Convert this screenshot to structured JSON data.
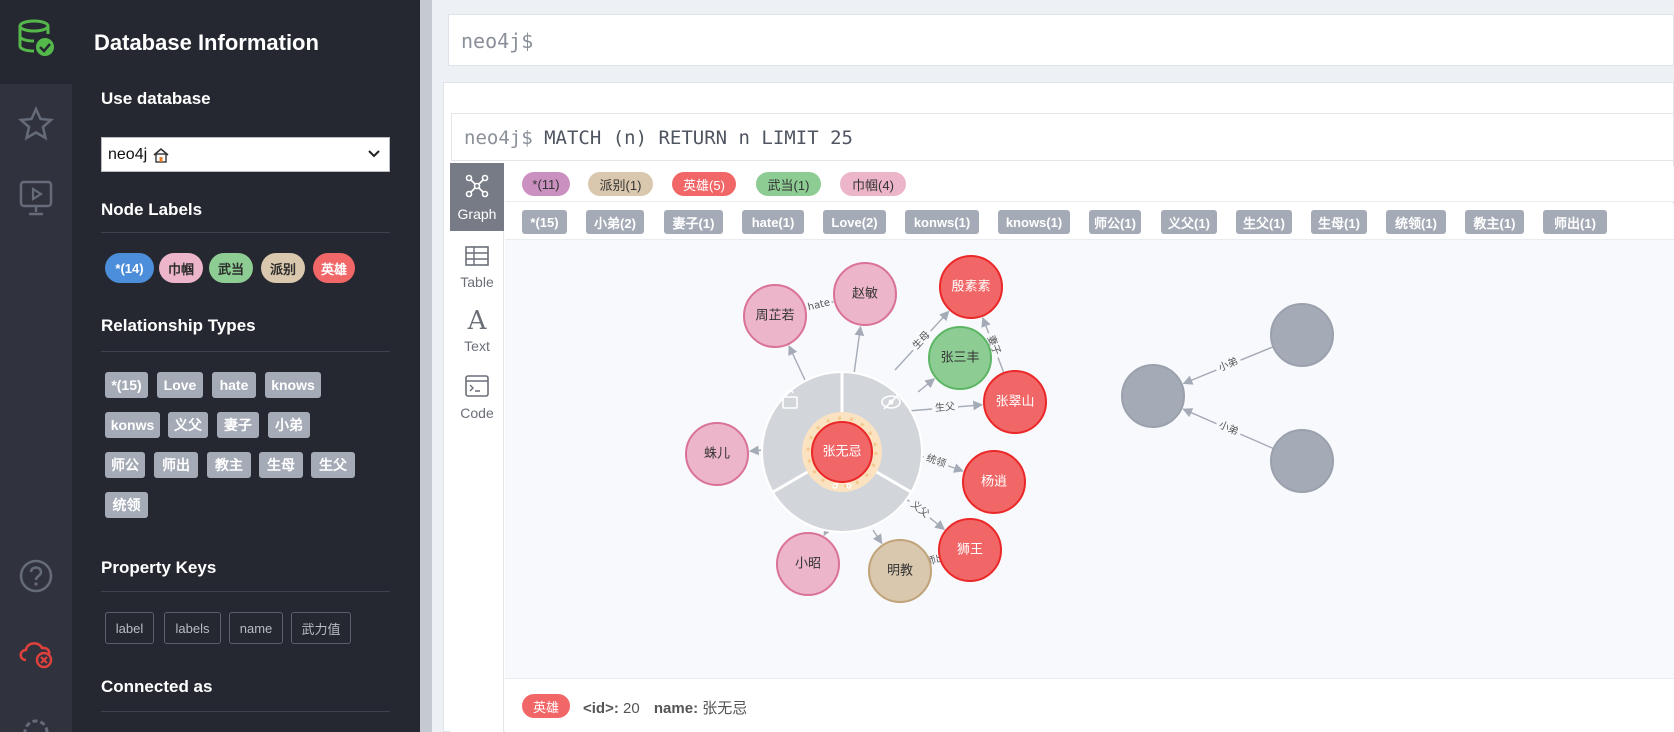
{
  "drawer": {
    "title": "Database Information",
    "use_database": "Use database",
    "db_selected": "neo4j",
    "node_labels_heading": "Node Labels",
    "node_labels": [
      {
        "label": "*(14)",
        "color": "#4c8eda",
        "text_color": "#ffffff"
      },
      {
        "label": "巾帼",
        "color": "#ecb5c9",
        "text_color": "#2c2c2c"
      },
      {
        "label": "武当",
        "color": "#8dcc93",
        "text_color": "#2c2c2c"
      },
      {
        "label": "派别",
        "color": "#d9c8ae",
        "text_color": "#2c2c2c"
      },
      {
        "label": "英雄",
        "color": "#f16667",
        "text_color": "#ffffff"
      }
    ],
    "rel_types_heading": "Relationship Types",
    "rel_types": [
      "*(15)",
      "Love",
      "hate",
      "knows",
      "konws",
      "义父",
      "妻子",
      "小弟",
      "师公",
      "师出",
      "教主",
      "生母",
      "生父",
      "统领"
    ],
    "property_keys_heading": "Property Keys",
    "property_keys": [
      "label",
      "labels",
      "name",
      "武力值"
    ],
    "connected_as": "Connected as"
  },
  "editor": {
    "prompt": "neo4j$"
  },
  "result": {
    "prompt": "neo4j$",
    "query": "MATCH (n) RETURN n LIMIT 25",
    "tabs": [
      "Graph",
      "Table",
      "Text",
      "Code"
    ],
    "label_pills": [
      {
        "label": "*(11)",
        "color": "#c990c0"
      },
      {
        "label": "派别(1)",
        "color": "#d9c8ae"
      },
      {
        "label": "英雄(5)",
        "color": "#f16667"
      },
      {
        "label": "武当(1)",
        "color": "#8dcc93"
      },
      {
        "label": "巾帼(4)",
        "color": "#ecb5c9"
      }
    ],
    "rel_tags": [
      "*(15)",
      "小弟(2)",
      "妻子(1)",
      "hate(1)",
      "Love(2)",
      "konws(1)",
      "knows(1)",
      "师公(1)",
      "义父(1)",
      "生父(1)",
      "生母(1)",
      "统领(1)",
      "教主(1)",
      "师出(1)"
    ],
    "status": {
      "badge": "英雄",
      "id_key": "<id>:",
      "id_val": "20",
      "name_key": "name:",
      "name_val": "张无忌"
    }
  },
  "graph": {
    "nodes": {
      "zwj": {
        "name": "张无忌",
        "color": "#f16667",
        "stroke": "#eb2728",
        "text": "light"
      },
      "zzr": {
        "name": "周芷若",
        "color": "#ecb5c9",
        "stroke": "#da7298",
        "text": "dark"
      },
      "zm": {
        "name": "赵敏",
        "color": "#ecb5c9",
        "stroke": "#da7298",
        "text": "dark"
      },
      "yss": {
        "name": "殷素素",
        "color": "#f16667",
        "stroke": "#eb2728",
        "text": "light"
      },
      "zsf": {
        "name": "张三丰",
        "color": "#8dcc93",
        "stroke": "#5db665",
        "text": "dark"
      },
      "zcs": {
        "name": "张翠山",
        "color": "#f16667",
        "stroke": "#eb2728",
        "text": "light"
      },
      "ye": {
        "name": "杨逍",
        "color": "#f16667",
        "stroke": "#eb2728",
        "text": "light"
      },
      "sw": {
        "name": "狮王",
        "color": "#f16667",
        "stroke": "#eb2728",
        "text": "light"
      },
      "mj": {
        "name": "明教",
        "color": "#d9c8ae",
        "stroke": "#c0a378",
        "text": "dark"
      },
      "xz": {
        "name": "小昭",
        "color": "#ecb5c9",
        "stroke": "#da7298",
        "text": "dark"
      },
      "ze": {
        "name": "蛛儿",
        "color": "#ecb5c9",
        "stroke": "#da7298",
        "text": "dark"
      },
      "g1": {
        "name": "",
        "color": "#a5abb6",
        "stroke": "#9aa1ac",
        "text": "dark"
      },
      "g2": {
        "name": "",
        "color": "#a5abb6",
        "stroke": "#9aa1ac",
        "text": "dark"
      },
      "g3": {
        "name": "",
        "color": "#a5abb6",
        "stroke": "#9aa1ac",
        "text": "dark"
      }
    },
    "edges": [
      {
        "label": "hate"
      },
      {
        "label": "妻子"
      },
      {
        "label": "生母"
      },
      {
        "label": "生父"
      },
      {
        "label": "统领"
      },
      {
        "label": "义父"
      },
      {
        "label": "师出"
      },
      {
        "label": "小弟"
      },
      {
        "label": "小弟"
      }
    ]
  }
}
